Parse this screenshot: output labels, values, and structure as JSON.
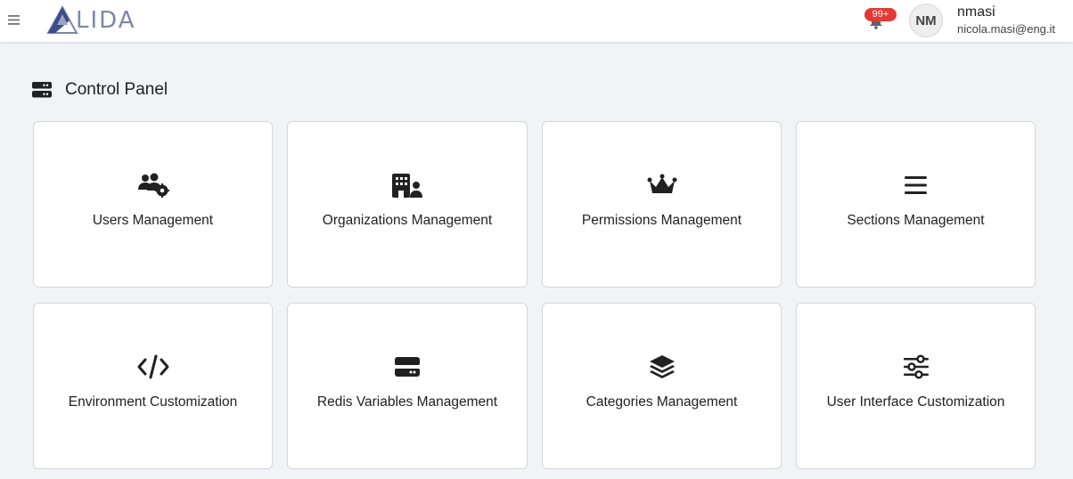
{
  "app": {
    "logo_text": "LIDA"
  },
  "header": {
    "notifications_badge": "99+",
    "avatar_initials": "NM",
    "user_name": "nmasi",
    "user_email": "nicola.masi@eng.it"
  },
  "page": {
    "title": "Control Panel"
  },
  "cards": [
    {
      "label": "Users Management",
      "icon": "users-gear-icon"
    },
    {
      "label": "Organizations Management",
      "icon": "building-user-icon"
    },
    {
      "label": "Permissions Management",
      "icon": "crown-icon"
    },
    {
      "label": "Sections Management",
      "icon": "bars-icon"
    },
    {
      "label": "Environment Customization",
      "icon": "code-icon"
    },
    {
      "label": "Redis Variables Management",
      "icon": "server-icon"
    },
    {
      "label": "Categories Management",
      "icon": "layer-group-icon"
    },
    {
      "label": "User Interface Customization",
      "icon": "sliders-icon"
    }
  ],
  "colors": {
    "accent": "#7d86a8",
    "badge": "#e53935",
    "background": "#f1f3f7"
  }
}
